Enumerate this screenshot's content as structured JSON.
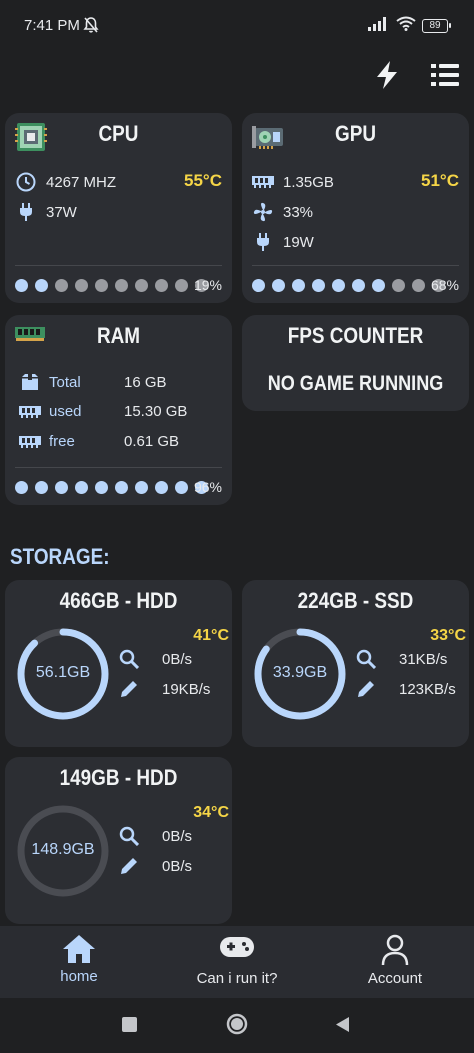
{
  "status_bar": {
    "time": "7:41 PM",
    "battery": "89"
  },
  "colors": {
    "accent": "#b9d6fb",
    "temp": "#f5d547",
    "card": "#2c2e33",
    "background": "#1f2022"
  },
  "top_bar": {
    "icons": [
      "lightning-icon",
      "list-icon"
    ]
  },
  "cpu": {
    "title": "CPU",
    "frequency": "4267 MHZ",
    "power": "37W",
    "temperature": "55°C",
    "usage_percent": "19%",
    "usage_fraction": 0.19
  },
  "gpu": {
    "title": "GPU",
    "memory": "1.35GB",
    "fan": "33%",
    "power": "19W",
    "temperature": "51°C",
    "usage_percent": "68%",
    "usage_fraction": 0.68
  },
  "ram": {
    "title": "RAM",
    "rows": [
      {
        "label": "Total",
        "value": "16 GB"
      },
      {
        "label": "used",
        "value": "15.30 GB"
      },
      {
        "label": "free",
        "value": "0.61 GB"
      }
    ],
    "usage_percent": "96%",
    "usage_fraction": 0.96
  },
  "fps": {
    "title": "FPS COUNTER",
    "status": "NO GAME RUNNING"
  },
  "storage": {
    "section_title": "STORAGE:",
    "drives": [
      {
        "title": "466GB - HDD",
        "used": "56.1GB",
        "temperature": "41°C",
        "read": "0B/s",
        "write": "19KB/s",
        "fill_fraction": 0.88
      },
      {
        "title": "224GB - SSD",
        "used": "33.9GB",
        "temperature": "33°C",
        "read": "31KB/s",
        "write": "123KB/s",
        "fill_fraction": 0.85
      },
      {
        "title": "149GB - HDD",
        "used": "148.9GB",
        "temperature": "34°C",
        "read": "0B/s",
        "write": "0B/s",
        "fill_fraction": 0.0
      }
    ]
  },
  "bottom_nav": {
    "items": [
      {
        "label": "home",
        "icon": "home-icon",
        "active": true
      },
      {
        "label": "Can i run it?",
        "icon": "gamepad-icon",
        "active": false
      },
      {
        "label": "Account",
        "icon": "account-icon",
        "active": false
      }
    ]
  }
}
